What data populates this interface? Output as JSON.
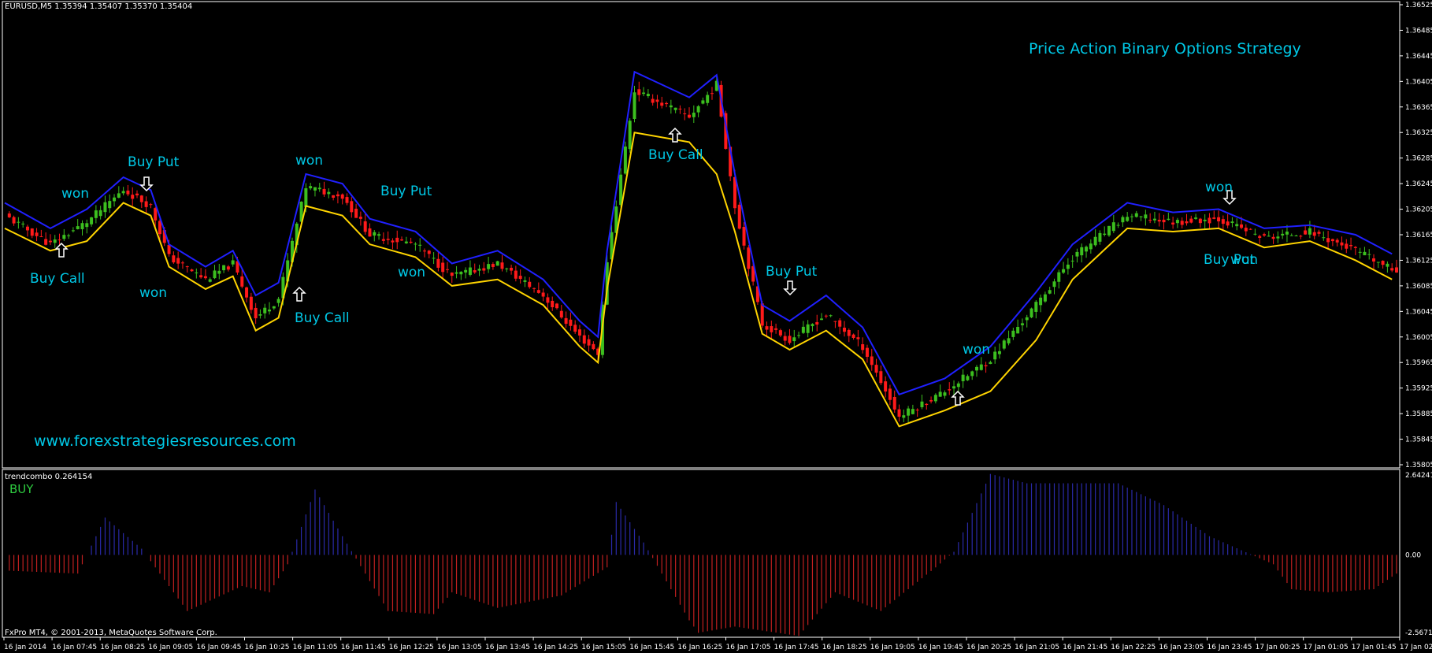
{
  "header": {
    "symbol_info": "EURUSD,M5  1.35394 1.35407 1.35370 1.35404"
  },
  "overlay": {
    "strategy_title": "Price Action Binary Options Strategy",
    "website": "www.forexstrategiesresources.com"
  },
  "indicator": {
    "label": "trendcombo 0.264154",
    "signal": "BUY"
  },
  "footer": {
    "copyright": "FxPro MT4, © 2001-2013, MetaQuotes Software Corp."
  },
  "colors": {
    "background": "#000000",
    "bull": "#3cbf1f",
    "bear": "#ff1a1a",
    "upper_band": "#2020ff",
    "lower_band": "#ffd400",
    "annotation": "#00c8e6",
    "hist_pos": "#2a2aa8",
    "hist_neg": "#c02020"
  },
  "chart_data": [
    {
      "type": "line",
      "chart_kind": "candlestick",
      "title": "",
      "y_ticks": [
        "1.36525",
        "1.36485",
        "1.36445",
        "1.36405",
        "1.36365",
        "1.36325",
        "1.36285",
        "1.36245",
        "1.36205",
        "1.36165",
        "1.36125",
        "1.36085",
        "1.36045",
        "1.36005",
        "1.35965",
        "1.35925",
        "1.35885",
        "1.35845",
        "1.35805"
      ],
      "ylim": [
        1.35805,
        1.36525
      ],
      "x_ticks": [
        "16 Jan 2014",
        "16 Jan 07:45",
        "16 Jan 08:25",
        "16 Jan 09:05",
        "16 Jan 09:45",
        "16 Jan 10:25",
        "16 Jan 11:05",
        "16 Jan 11:45",
        "16 Jan 12:25",
        "16 Jan 13:05",
        "16 Jan 13:45",
        "16 Jan 14:25",
        "16 Jan 15:05",
        "16 Jan 15:45",
        "16 Jan 16:25",
        "16 Jan 17:05",
        "16 Jan 17:45",
        "16 Jan 18:25",
        "16 Jan 19:05",
        "16 Jan 19:45",
        "16 Jan 20:25",
        "16 Jan 21:05",
        "16 Jan 21:45",
        "16 Jan 22:25",
        "16 Jan 23:05",
        "16 Jan 23:45",
        "17 Jan 00:25",
        "17 Jan 01:05",
        "17 Jan 01:45",
        "17 Jan 02:2"
      ],
      "close_path": [
        [
          0,
          1.36195
        ],
        [
          10,
          1.3615
        ],
        [
          18,
          1.36185
        ],
        [
          26,
          1.36235
        ],
        [
          32,
          1.3621
        ],
        [
          36,
          1.3613
        ],
        [
          44,
          1.36095
        ],
        [
          50,
          1.3612
        ],
        [
          55,
          1.36035
        ],
        [
          60,
          1.36065
        ],
        [
          66,
          1.3624
        ],
        [
          74,
          1.36225
        ],
        [
          80,
          1.36165
        ],
        [
          90,
          1.3615
        ],
        [
          98,
          1.361
        ],
        [
          108,
          1.3612
        ],
        [
          118,
          1.3607
        ],
        [
          126,
          1.36005
        ],
        [
          130,
          1.3598
        ],
        [
          132,
          1.36125
        ],
        [
          138,
          1.3639
        ],
        [
          150,
          1.3635
        ],
        [
          156,
          1.364
        ],
        [
          160,
          1.3621
        ],
        [
          166,
          1.36025
        ],
        [
          172,
          1.36
        ],
        [
          180,
          1.3604
        ],
        [
          188,
          1.3599
        ],
        [
          196,
          1.3588
        ],
        [
          206,
          1.3592
        ],
        [
          216,
          1.3597
        ],
        [
          226,
          1.36055
        ],
        [
          234,
          1.3613
        ],
        [
          246,
          1.36195
        ],
        [
          256,
          1.36185
        ],
        [
          266,
          1.3619
        ],
        [
          276,
          1.3616
        ],
        [
          286,
          1.3617
        ],
        [
          296,
          1.3614
        ],
        [
          304,
          1.3611
        ]
      ],
      "upper_band_path": [
        [
          0,
          1.36215
        ],
        [
          10,
          1.36175
        ],
        [
          18,
          1.36205
        ],
        [
          26,
          1.36255
        ],
        [
          32,
          1.36235
        ],
        [
          36,
          1.3615
        ],
        [
          44,
          1.36115
        ],
        [
          50,
          1.3614
        ],
        [
          55,
          1.3607
        ],
        [
          60,
          1.3609
        ],
        [
          66,
          1.3626
        ],
        [
          74,
          1.36245
        ],
        [
          80,
          1.3619
        ],
        [
          90,
          1.3617
        ],
        [
          98,
          1.3612
        ],
        [
          108,
          1.3614
        ],
        [
          118,
          1.36095
        ],
        [
          126,
          1.3603
        ],
        [
          130,
          1.36005
        ],
        [
          132,
          1.3614
        ],
        [
          138,
          1.3642
        ],
        [
          150,
          1.3638
        ],
        [
          156,
          1.36415
        ],
        [
          160,
          1.3626
        ],
        [
          166,
          1.36055
        ],
        [
          172,
          1.3603
        ],
        [
          180,
          1.3607
        ],
        [
          188,
          1.3602
        ],
        [
          196,
          1.35915
        ],
        [
          206,
          1.3594
        ],
        [
          216,
          1.3599
        ],
        [
          226,
          1.36075
        ],
        [
          234,
          1.3615
        ],
        [
          246,
          1.36215
        ],
        [
          256,
          1.362
        ],
        [
          266,
          1.36205
        ],
        [
          276,
          1.36175
        ],
        [
          286,
          1.3618
        ],
        [
          296,
          1.36165
        ],
        [
          304,
          1.36135
        ]
      ],
      "lower_band_path": [
        [
          0,
          1.36175
        ],
        [
          10,
          1.3614
        ],
        [
          18,
          1.36155
        ],
        [
          26,
          1.36215
        ],
        [
          32,
          1.36195
        ],
        [
          36,
          1.36115
        ],
        [
          44,
          1.3608
        ],
        [
          50,
          1.361
        ],
        [
          55,
          1.36015
        ],
        [
          60,
          1.36035
        ],
        [
          66,
          1.3621
        ],
        [
          74,
          1.36195
        ],
        [
          80,
          1.3615
        ],
        [
          90,
          1.3613
        ],
        [
          98,
          1.36085
        ],
        [
          108,
          1.36095
        ],
        [
          118,
          1.36055
        ],
        [
          126,
          1.3599
        ],
        [
          130,
          1.35965
        ],
        [
          132,
          1.3608
        ],
        [
          138,
          1.36325
        ],
        [
          150,
          1.3631
        ],
        [
          156,
          1.3626
        ],
        [
          160,
          1.3617
        ],
        [
          166,
          1.3601
        ],
        [
          172,
          1.35985
        ],
        [
          180,
          1.36015
        ],
        [
          188,
          1.3597
        ],
        [
          196,
          1.35865
        ],
        [
          206,
          1.3589
        ],
        [
          216,
          1.3592
        ],
        [
          226,
          1.36
        ],
        [
          234,
          1.36095
        ],
        [
          246,
          1.36175
        ],
        [
          256,
          1.3617
        ],
        [
          266,
          1.36175
        ],
        [
          276,
          1.36145
        ],
        [
          286,
          1.36155
        ],
        [
          296,
          1.36125
        ],
        [
          304,
          1.36095
        ]
      ]
    },
    {
      "type": "bar",
      "title": "trendcombo 0.264154",
      "y_ticks": [
        "2.642412",
        "0.00",
        "-2.567188"
      ],
      "ylim": [
        -2.567188,
        2.642412
      ],
      "x": [
        0,
        16,
        22,
        30,
        40,
        52,
        58,
        62,
        68,
        74,
        84,
        94,
        98,
        108,
        122,
        132,
        134,
        140,
        150,
        152,
        160,
        174,
        182,
        192,
        204,
        208,
        216,
        224,
        244,
        254,
        264,
        278,
        282,
        290,
        300,
        305
      ],
      "values": [
        -0.5,
        -0.6,
        1.2,
        0.2,
        -1.8,
        -1.0,
        -1.2,
        -0.3,
        2.1,
        0.6,
        -1.8,
        -1.9,
        -1.2,
        -1.7,
        -1.3,
        -0.4,
        1.7,
        0.4,
        -2.1,
        -2.5,
        -2.3,
        -2.6,
        -1.2,
        -1.8,
        -0.4,
        0.1,
        2.6,
        2.3,
        2.3,
        1.6,
        0.6,
        -0.3,
        -1.1,
        -1.2,
        -1.1,
        -0.6
      ]
    }
  ],
  "annotations": [
    {
      "text": "won"
    },
    {
      "text": "Buy Put"
    },
    {
      "text": "Buy Call"
    },
    {
      "text": "won"
    },
    {
      "text": "won"
    },
    {
      "text": "Buy Put"
    },
    {
      "text": "Buy Call"
    },
    {
      "text": "won"
    },
    {
      "text": "Buy Call"
    },
    {
      "text": "Buy Put"
    },
    {
      "text": "won"
    },
    {
      "text": "won"
    },
    {
      "text": "Buy Put"
    },
    {
      "text": "won"
    }
  ]
}
